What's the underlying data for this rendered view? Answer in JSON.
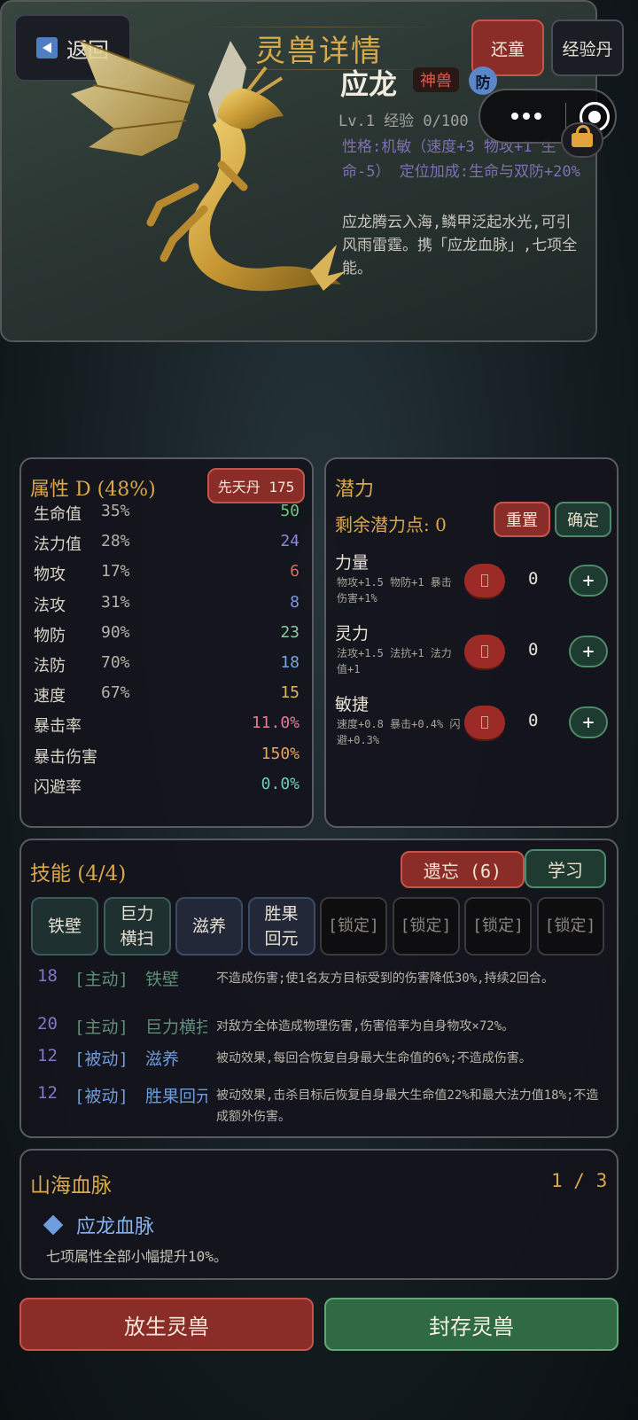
{
  "header": {
    "back_label": "返回",
    "title": "灵兽详情",
    "restore_label": "还童",
    "exp_label": "经验丹"
  },
  "pet": {
    "name": "应龙",
    "tag": "神兽",
    "role_badge": "防",
    "level_exp": "Lv.1  经验 0/100",
    "nature": "性格:机敏（速度+3 物攻+1 生命-5）  定位加成:生命与双防+20%",
    "desc": "应龙腾云入海,鳞甲泛起水光,可引风雨雷霆。携「应龙血脉」,七项全能。"
  },
  "attributes": {
    "title": "属性 D (48%)",
    "xiantian_label": "先天丹 175",
    "rows": [
      {
        "name": "生命值",
        "pct": "35%",
        "value": "50",
        "color": "#6fc47c"
      },
      {
        "name": "法力值",
        "pct": "28%",
        "value": "24",
        "color": "#8c86e0"
      },
      {
        "name": "物攻",
        "pct": "17%",
        "value": "6",
        "color": "#e0695c"
      },
      {
        "name": "法攻",
        "pct": "31%",
        "value": "8",
        "color": "#7c95e6"
      },
      {
        "name": "物防",
        "pct": "90%",
        "value": "23",
        "color": "#8ccaa0"
      },
      {
        "name": "法防",
        "pct": "70%",
        "value": "18",
        "color": "#6fa6e8"
      },
      {
        "name": "速度",
        "pct": "67%",
        "value": "15",
        "color": "#e0b55c"
      },
      {
        "name": "暴击率",
        "pct": "",
        "value": "11.0%",
        "color": "#e07c92"
      },
      {
        "name": "暴击伤害",
        "pct": "",
        "value": "150%",
        "color": "#e8a35a"
      },
      {
        "name": "闪避率",
        "pct": "",
        "value": "0.0%",
        "color": "#6ecdb8"
      }
    ]
  },
  "potential": {
    "title": "潜力",
    "remaining": "剩余潜力点: 0",
    "reset_label": "重置",
    "confirm_label": "确定",
    "items": [
      {
        "name": "力量",
        "effect": "物攻+1.5 物防+1 暴击伤害+1%",
        "value": "0",
        "plus": "+"
      },
      {
        "name": "灵力",
        "effect": "法攻+1.5 法抗+1 法力值+1",
        "value": "0",
        "plus": "+"
      },
      {
        "name": "敏捷",
        "effect": "速度+0.8 暴击+0.4% 闪避+0.3%",
        "value": "0",
        "plus": "+"
      }
    ]
  },
  "skills": {
    "title": "技能 (4/4)",
    "forget_label": "遗忘 (6)",
    "learn_label": "学习",
    "slots": [
      "铁壁",
      "巨力横扫",
      "滋养",
      "胜果回元",
      "[锁定]",
      "[锁定]",
      "[锁定]",
      "[锁定]"
    ],
    "list": [
      {
        "level": "18",
        "type": "[主动]",
        "name": "铁壁",
        "desc": "不造成伤害;使1名友方目标受到的伤害降低30%,持续2回合。",
        "color": "#5e8e76"
      },
      {
        "level": "20",
        "type": "[主动]",
        "name": "巨力横扫",
        "desc": "对敌方全体造成物理伤害,伤害倍率为自身物攻×72%。",
        "color": "#5e8e76"
      },
      {
        "level": "12",
        "type": "[被动]",
        "name": "滋养",
        "desc": "被动效果,每回合恢复自身最大生命值的6%;不造成伤害。",
        "color": "#6f9bd8"
      },
      {
        "level": "12",
        "type": "[被动]",
        "name": "胜果回元",
        "desc": "被动效果,击杀目标后恢复自身最大生命值22%和最大法力值18%;不造成额外伤害。",
        "color": "#6f9bd8"
      }
    ]
  },
  "bloodline": {
    "title": "山海血脉",
    "count": "1 / 3",
    "name": "应龙血脉",
    "desc": "七项属性全部小幅提升10%。"
  },
  "footer": {
    "release_label": "放生灵兽",
    "seal_label": "封存灵兽"
  }
}
